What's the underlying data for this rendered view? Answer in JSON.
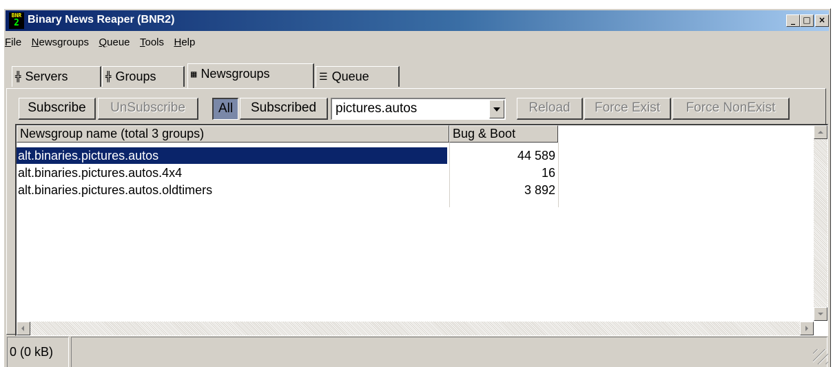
{
  "window": {
    "title": "Binary News Reaper (BNR2)",
    "icon_top": "BNR",
    "icon_bottom": "2"
  },
  "title_buttons": {
    "minimize": "_",
    "maximize": "□",
    "close": "×"
  },
  "menu": [
    "File",
    "Newsgroups",
    "Queue",
    "Tools",
    "Help"
  ],
  "tabs": [
    {
      "label": "Servers",
      "icon": "tree-icon"
    },
    {
      "label": "Groups",
      "icon": "tree-icon"
    },
    {
      "label": "Newsgroups",
      "icon": "grid-icon",
      "active": true
    },
    {
      "label": "Queue",
      "icon": "list-icon"
    }
  ],
  "toolbar": {
    "subscribe": "Subscribe",
    "unsubscribe": "UnSubscribe",
    "all": "All",
    "subscribed": "Subscribed",
    "filter_value": "pictures.autos",
    "reload": "Reload",
    "force_exist": "Force Exist",
    "force_nonexist": "Force NonExist"
  },
  "table": {
    "columns": [
      "Newsgroup name (total 3 groups)",
      "Bug & Boot"
    ],
    "rows": [
      {
        "name": "alt.binaries.pictures.autos",
        "count": "44 589",
        "selected": true
      },
      {
        "name": "alt.binaries.pictures.autos.4x4",
        "count": "16"
      },
      {
        "name": "alt.binaries.pictures.autos.oldtimers",
        "count": "3 892"
      }
    ]
  },
  "status": {
    "size": "0 (0 kB)"
  },
  "colors": {
    "titlebar": "#0a246a",
    "selection": "#0a246a",
    "face": "#d4d0c8"
  }
}
